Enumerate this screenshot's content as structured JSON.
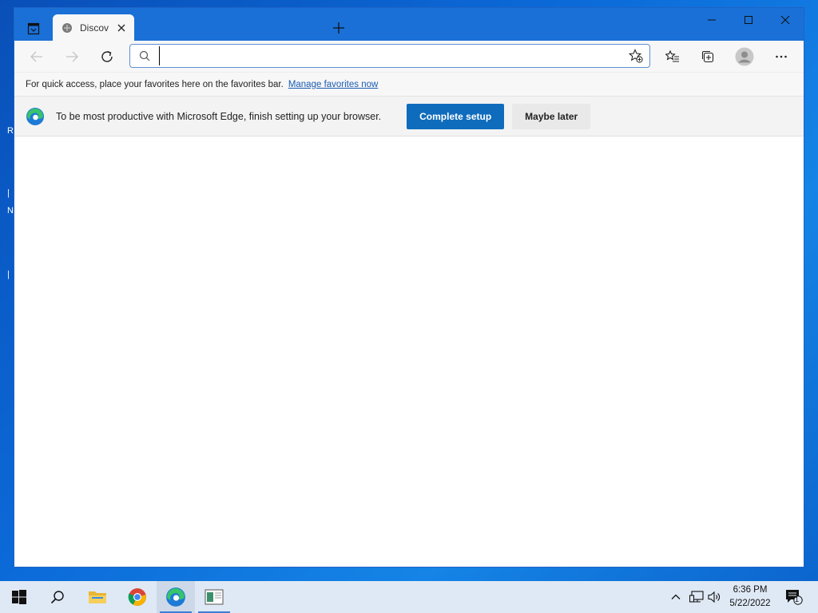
{
  "browser": {
    "tab": {
      "title": "Discov"
    },
    "address": {
      "value": "",
      "placeholder": ""
    },
    "favorites_bar": {
      "message": "For quick access, place your favorites here on the favorites bar.",
      "link": "Manage favorites now"
    },
    "infobar": {
      "message": "To be most productive with Microsoft Edge, finish setting up your browser.",
      "primary_button": "Complete setup",
      "secondary_button": "Maybe later"
    }
  },
  "taskbar": {
    "time": "6:36 PM",
    "date": "5/22/2022",
    "notification_count": "1"
  },
  "colors": {
    "titlebar": "#1a70d6",
    "primary_button": "#0f6cbd",
    "desktop": "#0b6ad8",
    "taskbar": "#dfe9f5"
  }
}
